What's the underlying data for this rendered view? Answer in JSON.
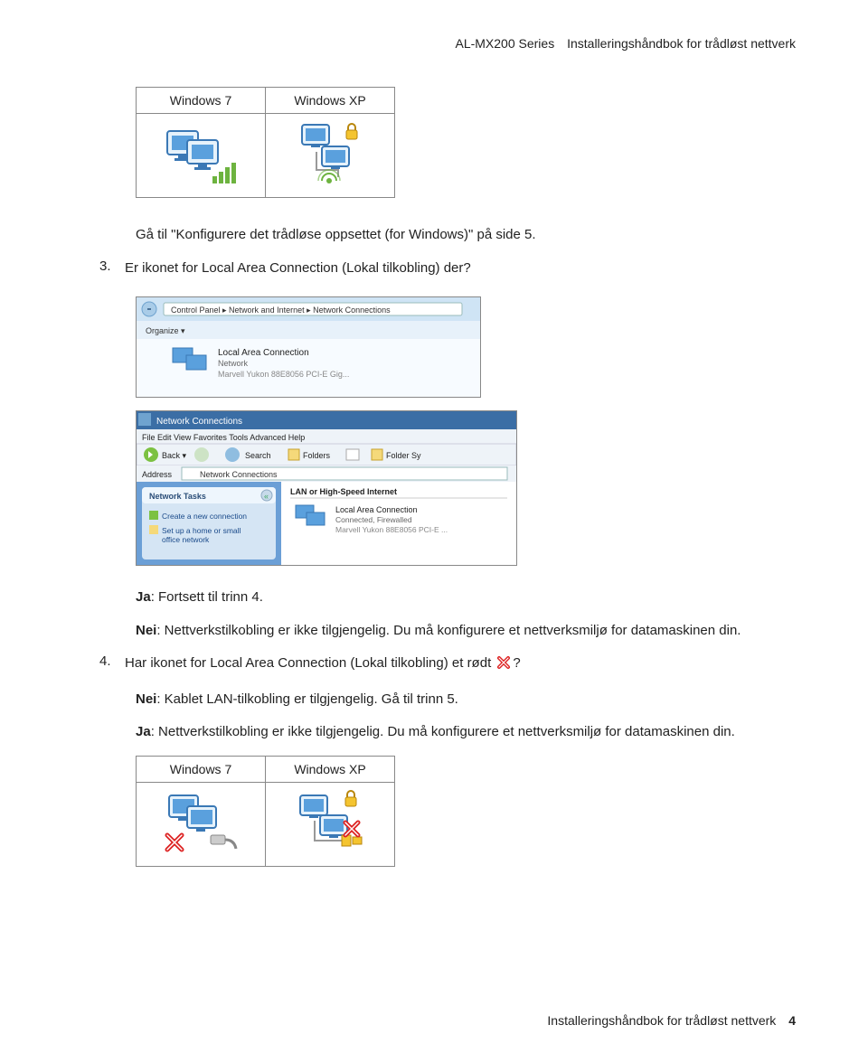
{
  "header": {
    "series": "AL-MX200 Series",
    "title": "Installeringshåndbok for trådløst nettverk"
  },
  "table1": {
    "col1": "Windows 7",
    "col2": "Windows XP"
  },
  "para_goto": "Gå til \"Konfigurere det trådløse oppsettet (for Windows)\" på side 5.",
  "step3": {
    "num": "3.",
    "text_pre": "Er ikonet for ",
    "bold": "Local Area Connection (Lokal tilkobling)",
    "text_post": " der?"
  },
  "ja_line": {
    "label": "Ja",
    "text": ": Fortsett til trinn 4."
  },
  "nei_line": {
    "label": "Nei",
    "text": ": Nettverkstilkobling er ikke tilgjengelig. Du må konfigurere et nettverksmiljø for datamaskinen din."
  },
  "step4": {
    "num": "4.",
    "text_pre": "Har ikonet for ",
    "bold": "Local Area Connection (Lokal tilkobling)",
    "text_post": " et rødt ",
    "q": "?"
  },
  "nei2": {
    "label": "Nei",
    "text": ": Kablet LAN-tilkobling er tilgjengelig. Gå til trinn 5."
  },
  "ja2": {
    "label": "Ja",
    "text": ": Nettverkstilkobling er ikke tilgjengelig. Du må konfigurere et nettverksmiljø for datamaskinen din."
  },
  "table2": {
    "col1": "Windows 7",
    "col2": "Windows XP"
  },
  "footer": {
    "text": "Installeringshåndbok for trådløst nettverk",
    "page": "4"
  }
}
